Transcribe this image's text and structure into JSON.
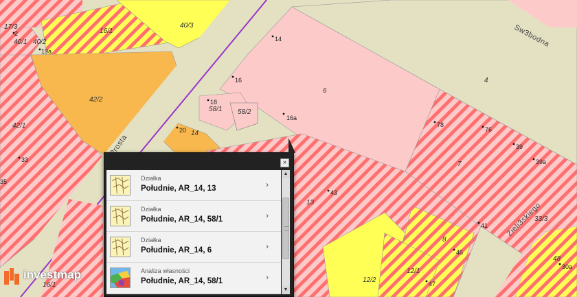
{
  "map": {
    "street_labels": [
      "Sw3bodna",
      "Zieli3skiego",
      "Prosta"
    ],
    "parcel_labels": [
      "17/3",
      "16/1",
      "40/3",
      "40/1",
      "40/2",
      "42/2",
      "42/1",
      "58/1",
      "58/2",
      "14",
      "6",
      "4",
      "7",
      "13",
      "8",
      "12/1",
      "12/2",
      "48",
      "16/1",
      "33/3"
    ],
    "address_labels": [
      "2",
      "19a",
      "14",
      "16",
      "18",
      "16a",
      "20",
      "78",
      "76",
      "39",
      "39a",
      "33",
      "43",
      "41",
      "45",
      "47",
      "30a",
      "35"
    ]
  },
  "popup": {
    "close_label": "×",
    "items": [
      {
        "type": "Działka",
        "title": "Południe, AR_14, 13",
        "icon": "parcel-map-icon"
      },
      {
        "type": "Działka",
        "title": "Południe, AR_14, 58/1",
        "icon": "parcel-map-icon"
      },
      {
        "type": "Działka",
        "title": "Południe, AR_14, 6",
        "icon": "parcel-map-icon"
      },
      {
        "type": "Analiza własności",
        "title": "Południe, AR_14, 58/1",
        "icon": "ownership-analysis-icon"
      }
    ],
    "arrow": "›"
  },
  "logo": {
    "text": "investmap"
  },
  "colors": {
    "road": "#e3e1c2",
    "residential_pink": "#fdcaca",
    "hatch_red": "#ff6b6b",
    "yellow": "#ffff55",
    "orange": "#f8b84e",
    "tram_line": "#9a33cc"
  }
}
